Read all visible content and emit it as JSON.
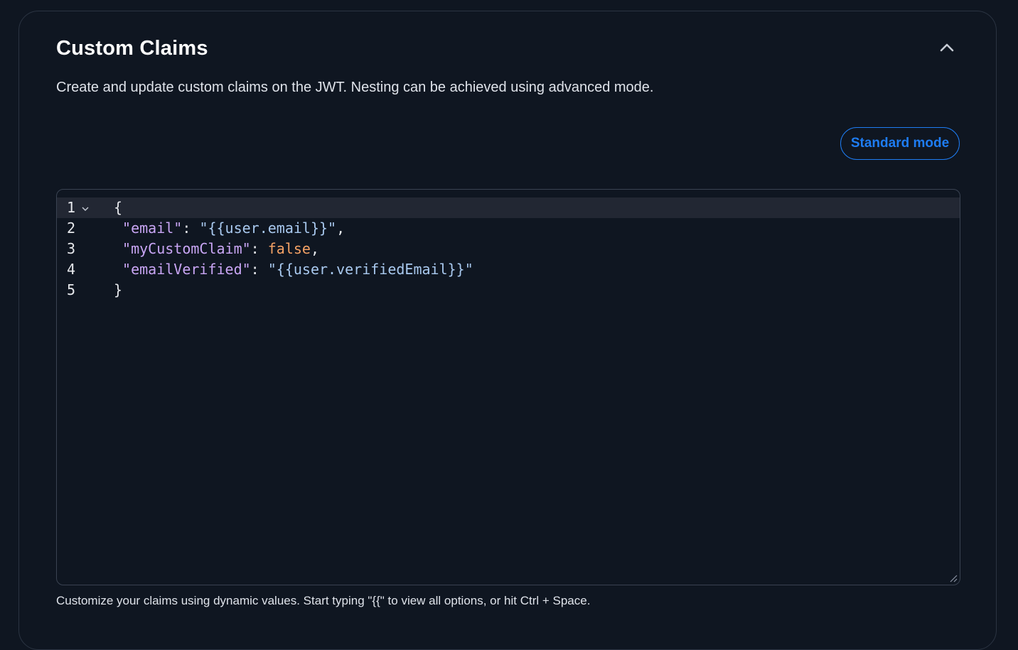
{
  "section": {
    "title": "Custom Claims",
    "description": "Create and update custom claims on the JWT. Nesting can be achieved using advanced mode.",
    "collapse_icon": "chevron-up-icon",
    "mode_button_label": "Standard mode",
    "hint": "Customize your claims using dynamic values. Start typing \"{{\" to view all options, or hit Ctrl + Space."
  },
  "editor": {
    "lines": [
      {
        "number": "1",
        "indent": "",
        "key": "",
        "sep": "",
        "value": "",
        "value_type": "",
        "trail": "",
        "text": "{"
      },
      {
        "number": "2",
        "indent": " ",
        "key": "\"email\"",
        "sep": ": ",
        "value": "\"{{user.email}}\"",
        "value_type": "str",
        "trail": ",",
        "text": ""
      },
      {
        "number": "3",
        "indent": " ",
        "key": "\"myCustomClaim\"",
        "sep": ": ",
        "value": "false",
        "value_type": "bool",
        "trail": ",",
        "text": ""
      },
      {
        "number": "4",
        "indent": " ",
        "key": "\"emailVerified\"",
        "sep": ": ",
        "value": "\"{{user.verifiedEmail}}\"",
        "value_type": "str",
        "trail": "",
        "text": ""
      },
      {
        "number": "5",
        "indent": "",
        "key": "",
        "sep": "",
        "value": "",
        "value_type": "",
        "trail": "",
        "text": "}"
      }
    ],
    "colors": {
      "key": "#c9a6f5",
      "string": "#a9c9ef",
      "boolean": "#f5a265",
      "active_line": "#222733"
    }
  },
  "colors": {
    "background": "#0f1621",
    "accent": "#1e7cf2",
    "border": "#2b3442"
  }
}
